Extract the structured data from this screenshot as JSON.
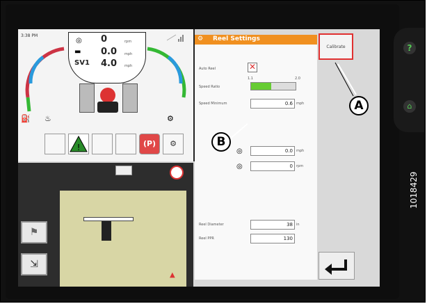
{
  "dashboard": {
    "time": "3:38 PM",
    "gauges": [
      {
        "label": "",
        "value": "0",
        "unit": "rpm"
      },
      {
        "label": "",
        "value": "0.0",
        "unit": "mph"
      },
      {
        "label": "SV1",
        "value": "4.0",
        "unit": "mph"
      }
    ]
  },
  "reel_settings": {
    "title": "Reel Settings",
    "auto_reel_label": "Auto Reel",
    "speed_ratio_label": "Speed Ratio",
    "speed_ratio_min": "1.1",
    "speed_ratio_max": "2.0",
    "speed_ratio_fill": 0.45,
    "speed_minimum_label": "Speed Minimum",
    "speed_minimum_value": "0.6",
    "speed_minimum_unit": "mph",
    "speed_value": "0.0",
    "speed_unit": "mph",
    "rpm_value": "0",
    "rpm_unit": "rpm",
    "reel_diameter_label": "Reel Diameter",
    "reel_diameter_value": "38",
    "reel_diameter_unit": "in",
    "reel_ppr_label": "Reel PPR",
    "reel_ppr_value": "130"
  },
  "calibrate_label": "Calibrate",
  "callouts": {
    "a": "A",
    "b": "B"
  },
  "doc_id": "1018429",
  "colors": {
    "header": "#F09020",
    "bar": "#66CC33",
    "alarm": "#E03030"
  }
}
